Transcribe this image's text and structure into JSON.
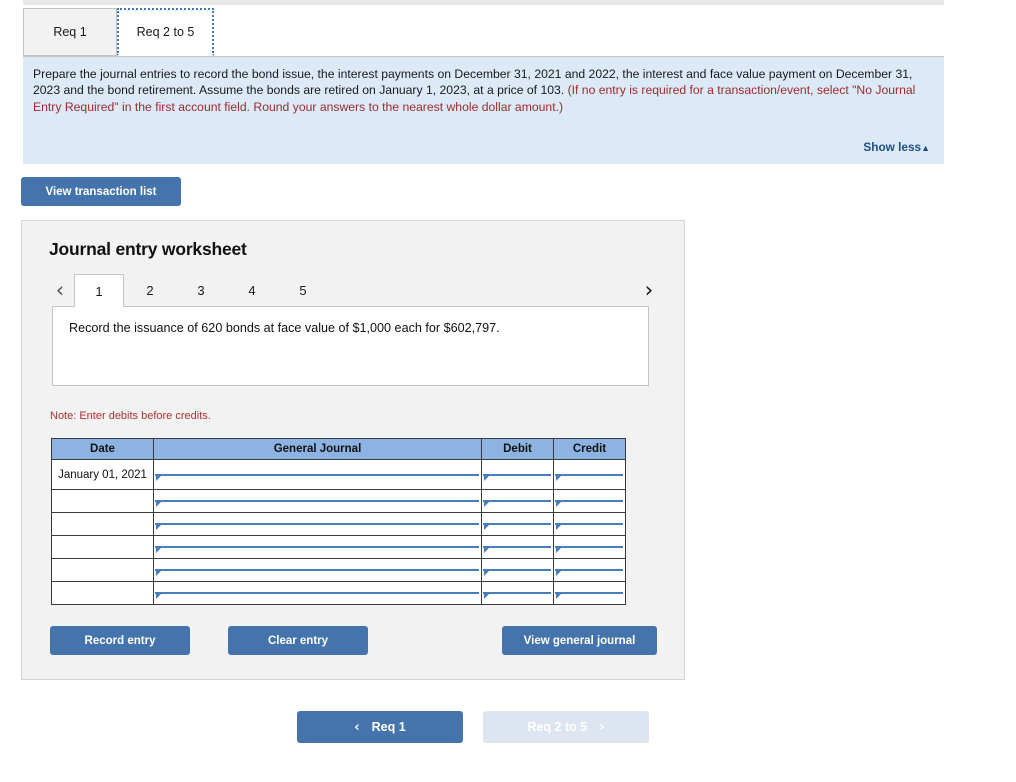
{
  "req_tabs": [
    {
      "label": "Req 1",
      "active": false
    },
    {
      "label": "Req 2 to 5",
      "active": true
    }
  ],
  "instructions": {
    "black_part": "Prepare the journal entries to record the bond issue, the interest payments on December 31, 2021 and 2022, the interest and face value payment on December 31, 2023 and the bond retirement. Assume the bonds are retired on January 1, 2023, at a price of 103. ",
    "red_part": "(If no entry is required for a transaction/event, select \"No Journal Entry Required\" in the first account field. Round your answers to the nearest whole dollar amount.)",
    "show_less_label": "Show less",
    "show_less_caret": "▲"
  },
  "toolbar": {
    "view_transaction_list_label": "View transaction list"
  },
  "worksheet": {
    "title": "Journal entry worksheet",
    "prev_arrow": "‹",
    "next_arrow": "›",
    "tabs": [
      {
        "label": "1",
        "active": true
      },
      {
        "label": "2",
        "active": false
      },
      {
        "label": "3",
        "active": false
      },
      {
        "label": "4",
        "active": false
      },
      {
        "label": "5",
        "active": false
      }
    ],
    "description": "Record the issuance of 620 bonds at face value of $1,000 each for $602,797.",
    "note": "Note: Enter debits before credits.",
    "table": {
      "headers": [
        "Date",
        "General Journal",
        "Debit",
        "Credit"
      ],
      "rows": [
        {
          "date": "January 01, 2021",
          "general_journal": "",
          "debit": "",
          "credit": ""
        },
        {
          "date": "",
          "general_journal": "",
          "debit": "",
          "credit": ""
        },
        {
          "date": "",
          "general_journal": "",
          "debit": "",
          "credit": ""
        },
        {
          "date": "",
          "general_journal": "",
          "debit": "",
          "credit": ""
        },
        {
          "date": "",
          "general_journal": "",
          "debit": "",
          "credit": ""
        },
        {
          "date": "",
          "general_journal": "",
          "debit": "",
          "credit": ""
        }
      ]
    },
    "buttons": {
      "record_entry": "Record entry",
      "clear_entry": "Clear entry",
      "view_general_journal": "View general journal"
    }
  },
  "bottom_nav": {
    "prev_label": "Req 1",
    "prev_chevron": "‹",
    "next_label": "Req 2 to 5",
    "next_chevron": "›"
  },
  "colors": {
    "accent_blue": "#4574ad",
    "panel_blue": "#dce9f7",
    "table_header_blue": "#8db3e2",
    "red_text": "#9d2b2b",
    "link_blue": "#1f4e84"
  }
}
